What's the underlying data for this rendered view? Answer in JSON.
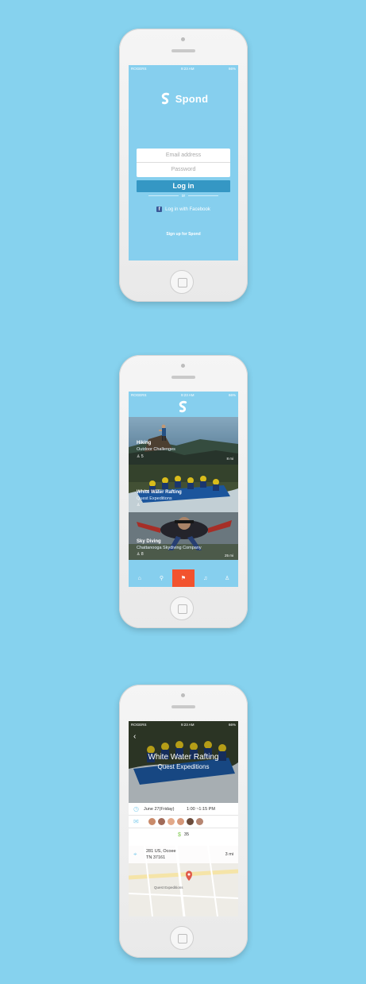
{
  "colors": {
    "background": "#86d2ee",
    "screen": "#86cfee",
    "login_button": "#3597c4",
    "accent": "#f2532e",
    "facebook": "#3b5998"
  },
  "status_bar": {
    "carrier": "ROGERS",
    "time": "9:23 AM",
    "battery": "66%"
  },
  "login": {
    "app_name": "Spond",
    "email_placeholder": "Email address",
    "password_placeholder": "Password",
    "login_label": "Log in",
    "or_label": "or",
    "facebook_label": "Log in with Facebook",
    "signup_label": "Sign up for Spond"
  },
  "feed": {
    "cards": [
      {
        "title": "Hiking",
        "subtitle": "Outdoor Challenges",
        "count": "5",
        "distance": "8 mi"
      },
      {
        "title": "White Water Rafting",
        "subtitle": "Quest Expeditions",
        "count": "",
        "distance": ""
      },
      {
        "title": "Sky Diving",
        "subtitle": "Chattanooga Skydiving Company",
        "count": "8",
        "distance": "25 mi"
      }
    ],
    "tabs": [
      {
        "name": "home-icon",
        "glyph": "⌂"
      },
      {
        "name": "search-icon",
        "glyph": "⚲"
      },
      {
        "name": "activity-icon",
        "glyph": "⚑"
      },
      {
        "name": "bell-icon",
        "glyph": "♫"
      },
      {
        "name": "profile-icon",
        "glyph": "♙"
      }
    ]
  },
  "detail": {
    "title": "White Water Rafting",
    "subtitle": "Quest Expeditions",
    "date": "June 27(Friday)",
    "time": "1:00 ~1:15 PM",
    "price": "35",
    "address_line1": "281 US, Ocoee",
    "address_line2": "TN 37161",
    "distance": "3 mi",
    "map_label": "Quest Expeditions"
  }
}
